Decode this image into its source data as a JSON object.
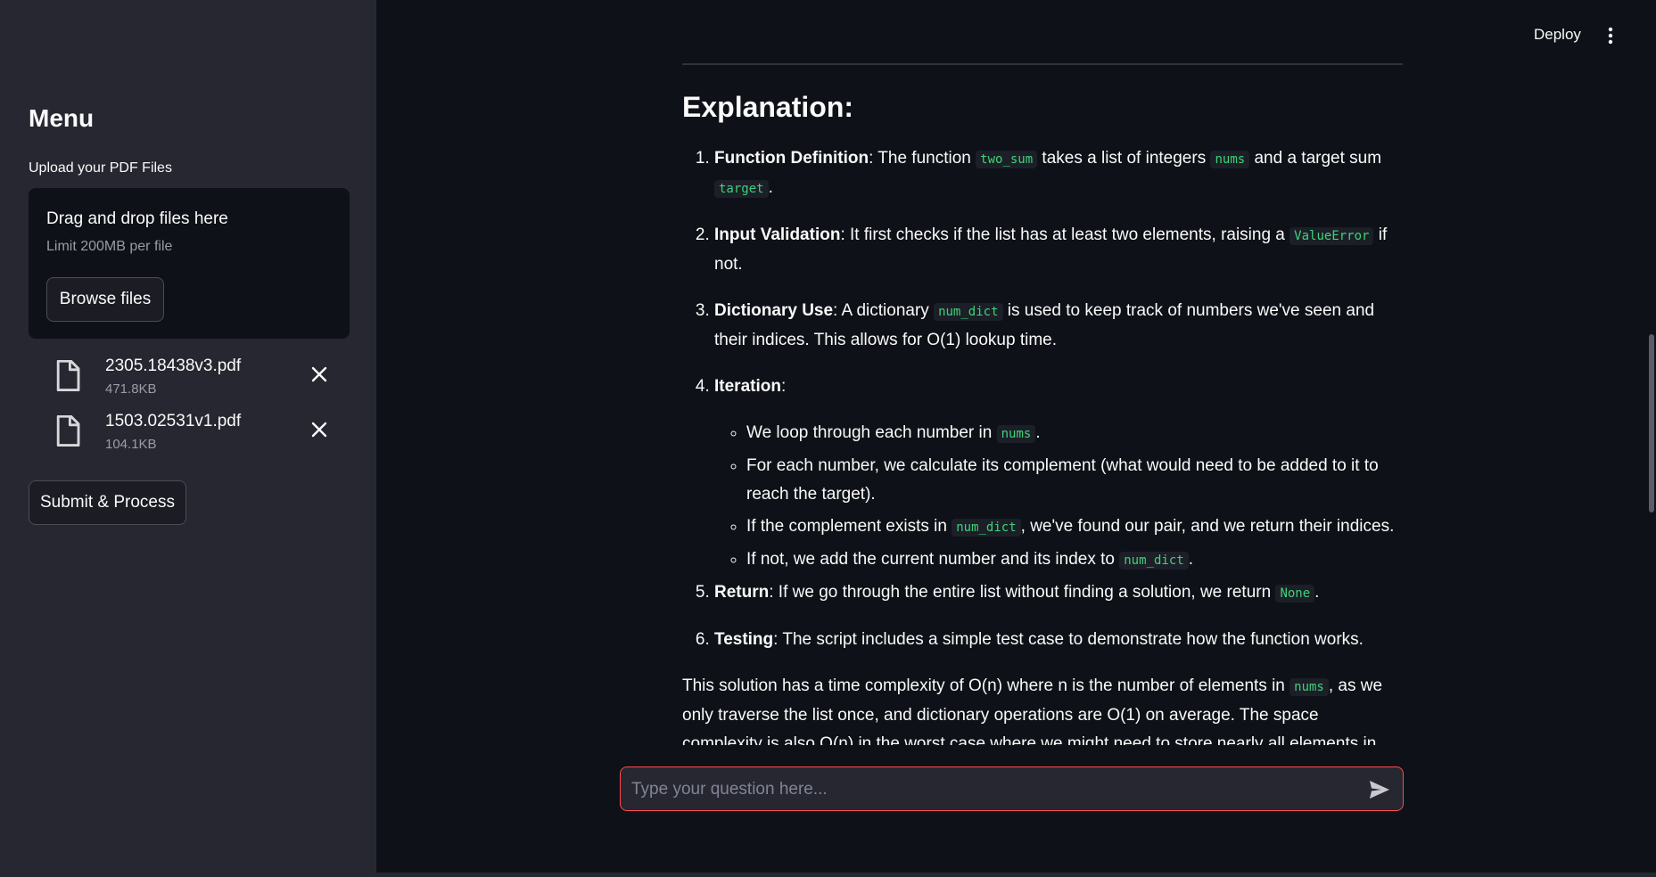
{
  "sidebar": {
    "title": "Menu",
    "upload_label": "Upload your PDF Files",
    "dropzone": {
      "title": "Drag and drop files here",
      "limit": "Limit 200MB per file",
      "browse_label": "Browse files"
    },
    "files": [
      {
        "name": "2305.18438v3.pdf",
        "size": "471.8KB"
      },
      {
        "name": "1503.02531v1.pdf",
        "size": "104.1KB"
      }
    ],
    "submit_label": "Submit & Process"
  },
  "header": {
    "deploy_label": "Deploy",
    "menu_icon": "kebab-menu-icon"
  },
  "content": {
    "heading": "Explanation:",
    "items": [
      {
        "strong": "Function Definition",
        "t1": ": The function ",
        "c1": "two_sum",
        "t2": " takes a list of integers ",
        "c2": "nums",
        "t3": " and a target sum ",
        "c3": "target",
        "t4": "."
      },
      {
        "strong": "Input Validation",
        "t1": ": It first checks if the list has at least two elements, raising a ",
        "c1": "ValueError",
        "t2": " if not."
      },
      {
        "strong": "Dictionary Use",
        "t1": ": A dictionary ",
        "c1": "num_dict",
        "t2": " is used to keep track of numbers we've seen and their indices. This allows for O(1) lookup time."
      },
      {
        "strong": "Iteration",
        "t1": ":"
      },
      {
        "strong": "Return",
        "t1": ": If we go through the entire list without finding a solution, we return ",
        "c1": "None",
        "t2": "."
      },
      {
        "strong": "Testing",
        "t1": ": The script includes a simple test case to demonstrate how the function works."
      }
    ],
    "iteration_sub": [
      {
        "t1": "We loop through each number in ",
        "c1": "nums",
        "t2": "."
      },
      {
        "t1": "For each number, we calculate its complement (what would need to be added to it to reach the target)."
      },
      {
        "t1": "If the complement exists in ",
        "c1": "num_dict",
        "t2": ", we've found our pair, and we return their indices."
      },
      {
        "t1": "If not, we add the current number and its index to ",
        "c1": "num_dict",
        "t2": "."
      }
    ],
    "final": {
      "t1": "This solution has a time complexity of O(n) where n is the number of elements in ",
      "c1": "nums",
      "t2": ", as we only traverse the list once, and dictionary operations are O(1) on average. The space complexity is also O(n) in the worst case where we might need to store nearly all elements in the dictionary."
    }
  },
  "chat": {
    "placeholder": "Type your question here..."
  },
  "colors": {
    "accent": "#ff4b4b",
    "code_text": "#3fd27a",
    "sidebar_bg": "#262730",
    "main_bg": "#0e1117"
  }
}
